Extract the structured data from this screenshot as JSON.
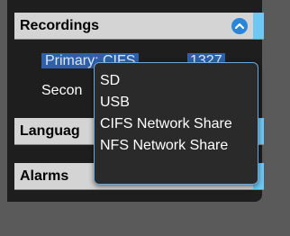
{
  "sections": {
    "recordings": {
      "title": "Recordings"
    },
    "language": {
      "title": "Languag"
    },
    "alarms": {
      "title": "Alarms"
    }
  },
  "recordings": {
    "primary": {
      "label": "Primary: CIFS",
      "value": "1327"
    },
    "secondary": {
      "label": "Secon"
    }
  },
  "dropdown": {
    "options": [
      "SD",
      "USB",
      "CIFS Network Share",
      "NFS Network Share"
    ]
  },
  "colors": {
    "accent": "#6ec8f5",
    "button": "#2a86d8",
    "selection": "#2e5fa8"
  },
  "icons": {
    "collapse": "chevron-up-icon"
  }
}
